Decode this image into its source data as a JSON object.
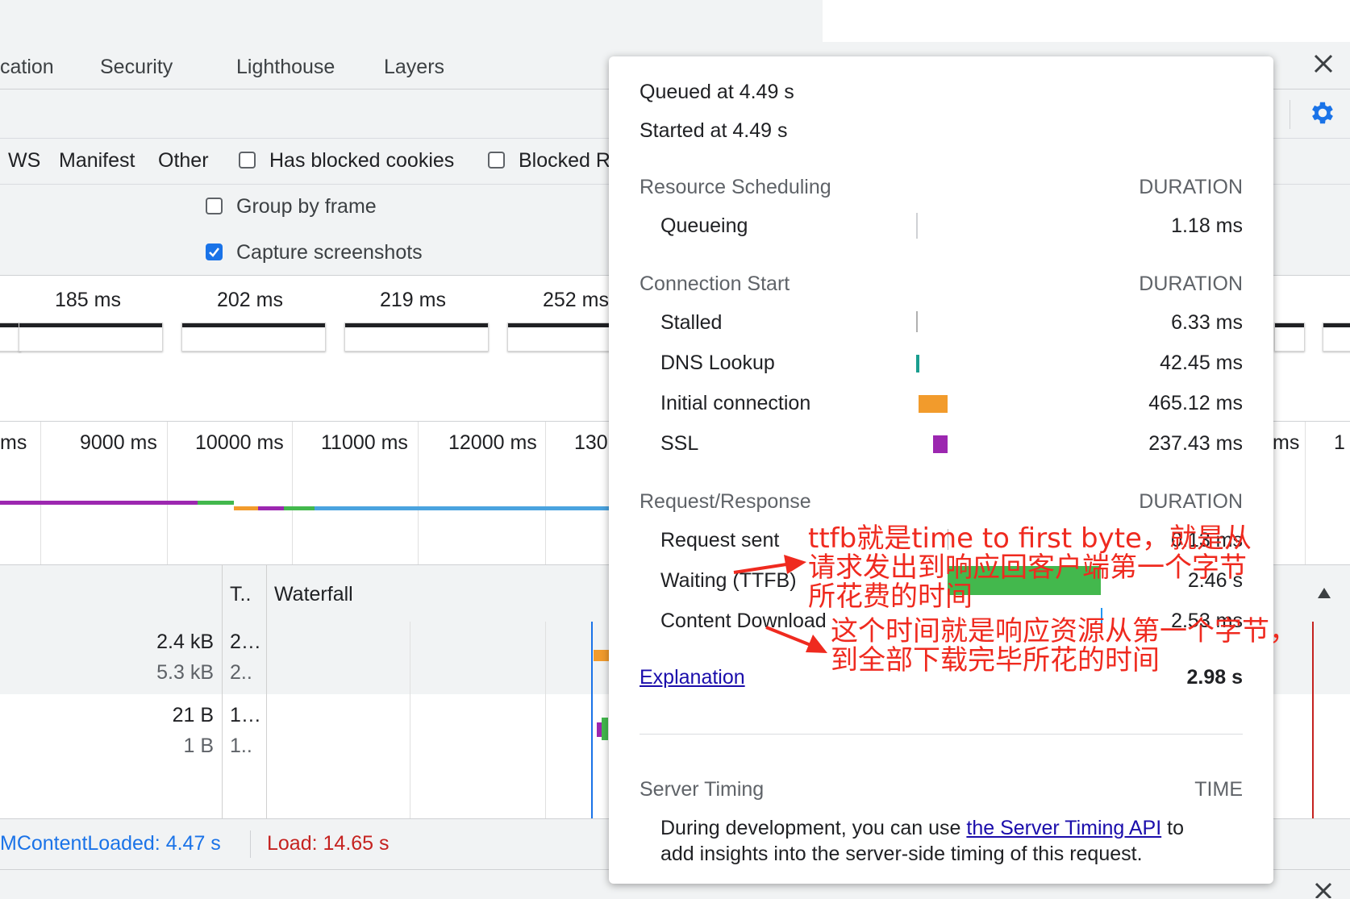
{
  "tabs": [
    "cation",
    "Security",
    "Lighthouse",
    "Layers"
  ],
  "filters": {
    "types": [
      "WS",
      "Manifest",
      "Other"
    ],
    "has_blocked_cookies": "Has blocked cookies",
    "blocked_partial": "Blocked R"
  },
  "options": {
    "group_by_frame": "Group by frame",
    "capture_screenshots": "Capture screenshots"
  },
  "screenshots": {
    "times": [
      "185 ms",
      "202 ms",
      "219 ms",
      "252 ms"
    ]
  },
  "overview": {
    "ticks": [
      "ms",
      "9000 ms",
      "10000 ms",
      "11000 ms",
      "12000 ms",
      "130",
      "ms",
      "1"
    ]
  },
  "table": {
    "col_t": "T..",
    "col_waterfall": "Waterfall",
    "rows": [
      {
        "size1": "2.4 kB",
        "time1": "2…",
        "size2": "5.3 kB",
        "time2": "2.."
      },
      {
        "size1": "21 B",
        "time1": "1…",
        "size2": "1 B",
        "time2": "1.."
      }
    ]
  },
  "status": {
    "dom_content_loaded": "MContentLoaded: 4.47 s",
    "load": "Load: 14.65 s"
  },
  "timing": {
    "queued": "Queued at 4.49 s",
    "started": "Started at 4.49 s",
    "duration_label": "DURATION",
    "sections": {
      "resource_scheduling": "Resource Scheduling",
      "connection_start": "Connection Start",
      "request_response": "Request/Response"
    },
    "rows": {
      "queueing": {
        "label": "Queueing",
        "value": "1.18 ms"
      },
      "stalled": {
        "label": "Stalled",
        "value": "6.33 ms"
      },
      "dns": {
        "label": "DNS Lookup",
        "value": "42.45 ms"
      },
      "initial": {
        "label": "Initial connection",
        "value": "465.12 ms"
      },
      "ssl": {
        "label": "SSL",
        "value": "237.43 ms"
      },
      "request_sent": {
        "label": "Request sent",
        "value": "0.13 ms"
      },
      "waiting": {
        "label": "Waiting (TTFB)",
        "value": "2.46 s"
      },
      "download": {
        "label": "Content Download",
        "value": "2.53 ms"
      }
    },
    "explanation": "Explanation",
    "total": "2.98 s",
    "server_timing": {
      "title": "Server Timing",
      "time_label": "TIME",
      "text_before": "During development, you can use ",
      "link": "the Server Timing API",
      "text_after": " to",
      "line2": "add insights into the server-side timing of this request."
    },
    "colors": {
      "dns": "#1a9e8f",
      "initial": "#f29b2c",
      "ssl": "#9c27b0",
      "waiting": "#43b84d",
      "download": "#2196f3",
      "annotation": "#ef2a1f"
    }
  },
  "annotations": {
    "ttfb": [
      "ttfb就是time  to first byte，就是从",
      "请求发出到响应回客户端第一个字节",
      "所花费的时间"
    ],
    "download": [
      "这个时间就是响应资源从第一个字节，",
      "到全部下载完毕所花的时间"
    ]
  }
}
